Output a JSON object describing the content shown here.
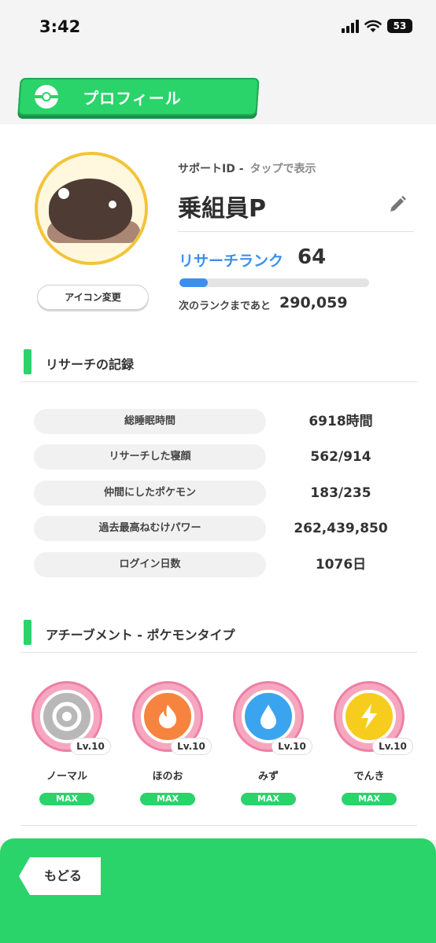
{
  "status_bar": {
    "time": "3:42",
    "battery": "53"
  },
  "header": {
    "title": "プロフィール"
  },
  "profile": {
    "support_id_label": "サポートID -",
    "support_id_tap": "タップで表示",
    "name": "乗組員P",
    "icon_change_label": "アイコン変更",
    "rank_label": "リサーチランク",
    "rank_value": "64",
    "rank_progress_fraction": 0.15,
    "next_rank_label": "次のランクまであと",
    "next_rank_value": "290,059"
  },
  "records": {
    "title": "リサーチの記録",
    "rows": [
      {
        "label": "総睡眠時間",
        "value": "6918時間"
      },
      {
        "label": "リサーチした寝顔",
        "value": "562/914"
      },
      {
        "label": "仲間にしたポケモン",
        "value": "183/235"
      },
      {
        "label": "過去最高ねむけパワー",
        "value": "262,439,850"
      },
      {
        "label": "ログイン日数",
        "value": "1076日"
      }
    ]
  },
  "achievements": {
    "title": "アチーブメント - ポケモンタイプ",
    "badges": [
      {
        "name": "ノーマル",
        "level": "Lv.10",
        "max": "MAX",
        "icon": "normal-type-icon",
        "color": "#b8b8b8"
      },
      {
        "name": "ほのお",
        "level": "Lv.10",
        "max": "MAX",
        "icon": "fire-type-icon",
        "color": "#f6843f"
      },
      {
        "name": "みず",
        "level": "Lv.10",
        "max": "MAX",
        "icon": "water-type-icon",
        "color": "#3aa5ee"
      },
      {
        "name": "でんき",
        "level": "Lv.10",
        "max": "MAX",
        "icon": "electric-type-icon",
        "color": "#f6cd1c"
      }
    ]
  },
  "footer": {
    "back_label": "もどる"
  },
  "colors": {
    "accent_green": "#2bd36b",
    "rank_blue": "#3b8ff0",
    "avatar_ring": "#f2c43a"
  }
}
